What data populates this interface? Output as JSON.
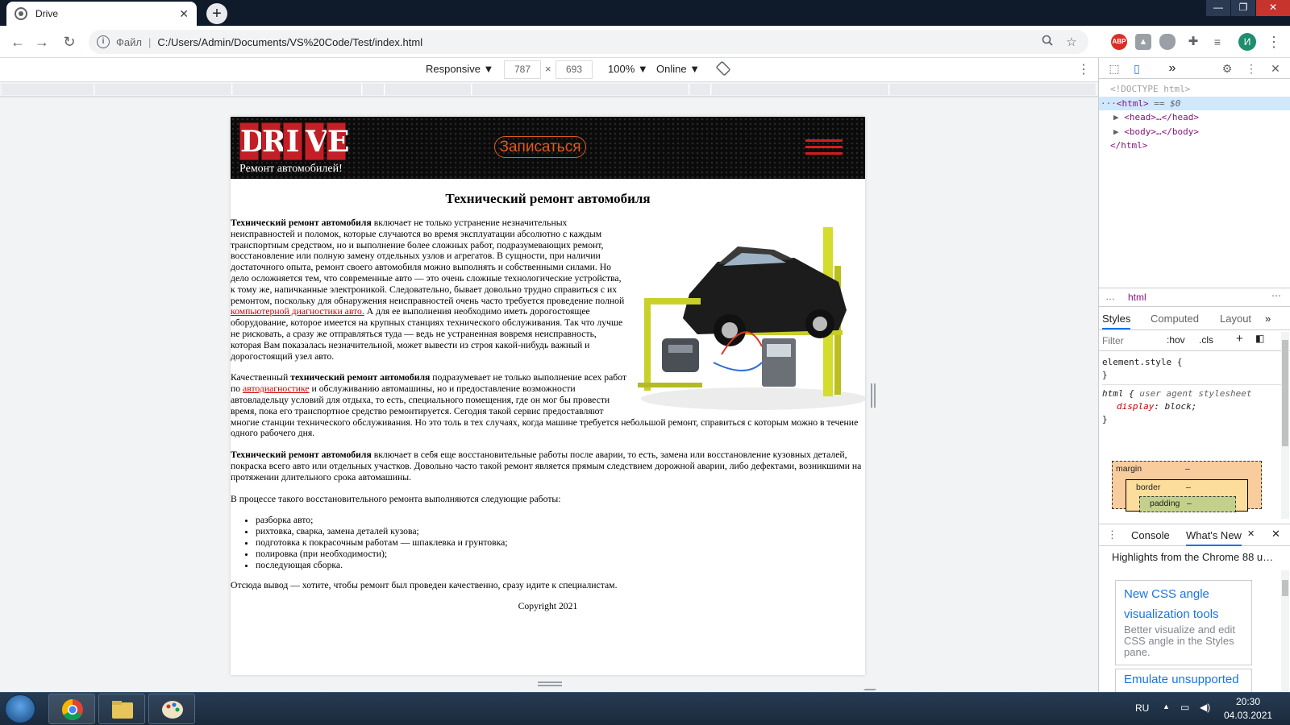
{
  "browser": {
    "tab_title": "Drive",
    "tab_close": "✕",
    "new_tab": "+",
    "back": "←",
    "forward": "→",
    "reload": "↻",
    "address": {
      "info": "i",
      "scheme_label": "Файл",
      "separator": "|",
      "url": "C:/Users/Admin/Documents/VS%20Code/Test/index.html"
    },
    "profile_initial": "И",
    "menu": "⋮",
    "window_controls": {
      "minimize": "—",
      "maximize": "❐",
      "close": "✕"
    }
  },
  "device_toolbar": {
    "device": "Responsive ▼",
    "width": "787",
    "times": "×",
    "height": "693",
    "zoom": "100% ▼",
    "throttle": "Online ▼",
    "more": "⋮"
  },
  "site": {
    "logo_letters": [
      "D",
      "R",
      "I",
      "V",
      "E"
    ],
    "tagline": "Ремонт автомобилей!",
    "signup_button": "Записаться",
    "heading": "Технический ремонт автомобиля",
    "p1_bold": "Технический ремонт автомобиля",
    "p1_text": " включает не только устранение незначительных неисправностей и поломок, которые случаются во время эксплуатации абсолютно с каждым транспортным средством, но и выполнение более сложных работ, подразумевающих ремонт, восстановление или полную замену отдельных узлов и агрегатов. В сущности, при наличии достаточного опыта, ремонт своего автомобиля можно выполнять и собственными силами. Но дело осложняется тем, что современные авто — это очень сложные технологические устройства, к тому же, напичканные электроникой. Следовательно, бывает довольно трудно справиться с их ремонтом, поскольку для обнаружения неисправностей очень часто требуется проведение полной ",
    "p1_link": "компьютерной диагностики авто.",
    "p1_text2": " А для ее выполнения необходимо иметь дорогостоящее оборудование, которое имеется на крупных станциях технического обслуживания. Так что лучше не рисковать, а сразу же отправляться туда — ведь не устраненная вовремя неисправность, которая Вам показалась незначительной, может вывести из строя какой-нибудь важный и дорогостоящий узел авто.",
    "p2_text1": "Качественный ",
    "p2_bold": "технический ремонт автомобиля",
    "p2_text2": " подразумевает не только выполнение всех работ по ",
    "p2_link": "автодиагностике",
    "p2_text3": " и обслуживанию автомашины, но и предоставление возможности автовладельцу условий для отдыха, то есть, специального помещения, где он мог бы провести время, пока его транспортное средство ремонтируется. Сегодня такой сервис предоставляют многие станции технического обслуживания. Но это толь в тех случаях, когда машине требуется небольшой ремонт, справиться с которым можно в течение одного рабочего дня.",
    "p3_bold": "Технический ремонт автомобиля",
    "p3_text": " включает в себя еще восстановительные работы после аварии, то есть, замена или восстановление кузовных деталей, покраска всего авто или отдельных участков. Довольно часто такой ремонт является прямым следствием дорожной аварии, либо дефектами, возникшими на протяжении длительного срока автомашины.",
    "p4": "В процессе такого восстановительного ремонта выполняются следующие работы:",
    "list": [
      "разборка авто;",
      "рихтовка, сварка, замена деталей кузова;",
      "подготовка к покрасочным работам — шпаклевка и грунтовка;",
      "полировка (при необходимости);",
      "последующая сборка."
    ],
    "p5": "Отсюда вывод — хотите, чтобы ремонт был проведен качественно, сразу идите к специалистам.",
    "copyright": "Copyright 2021",
    "colors": {
      "logo_red": "#c41f26",
      "signup_orange": "#e05a1c",
      "burger_red": "#d61d1d",
      "link_red": "#cc0000"
    }
  },
  "devtools": {
    "more_tabs": "»",
    "dom": {
      "doctype": "<!DOCTYPE html>",
      "html_open": "<html>",
      "selected_marker": " == $0",
      "head": "<head>…</head>",
      "body": "<body>…</body>",
      "html_close": "</html>"
    },
    "breadcrumb": "html",
    "breadcrumb_dots": "…",
    "panel_tabs": [
      "Styles",
      "Computed",
      "Layout"
    ],
    "filter_placeholder": "Filter",
    "hov": ":hov",
    "cls": ".cls",
    "styles": {
      "element_style": "element.style {",
      "close_brace": "}",
      "html_selector": "html {",
      "ua_label": "user agent stylesheet",
      "prop_name": "display",
      "prop_value": "block;"
    },
    "box_model": {
      "margin": "margin",
      "border": "border",
      "padding": "padding",
      "dash": "–"
    },
    "drawer_tabs": [
      "Console",
      "What's New"
    ],
    "highlights": "Highlights from the Chrome 88 u…",
    "card_title": "New CSS angle visualization tools",
    "card_desc": "Better visualize and edit CSS angle in the Styles pane.",
    "card2_title": "Emulate unsupported"
  },
  "taskbar": {
    "lang": "RU",
    "time": "20:30",
    "date": "04.03.2021",
    "tray_arrow": "▲"
  }
}
